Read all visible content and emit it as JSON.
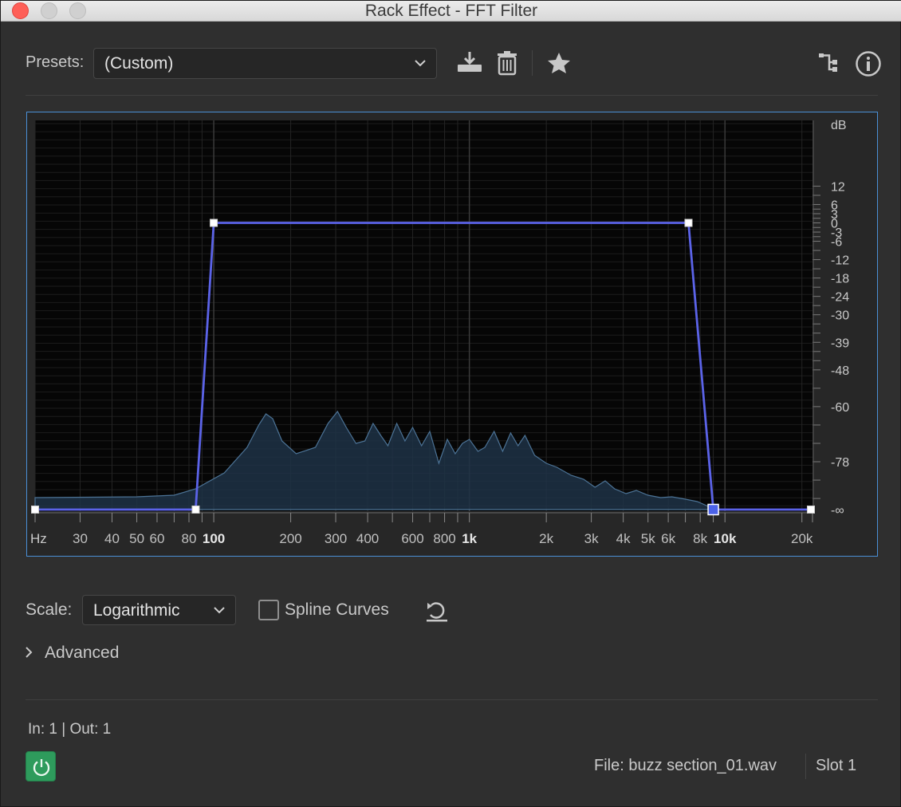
{
  "window": {
    "title": "Rack Effect - FFT Filter"
  },
  "header": {
    "presets_label": "Presets:",
    "preset_value": "(Custom)",
    "icons": [
      "save-preset-icon",
      "delete-icon",
      "favorite-star-icon",
      "routing-icon",
      "info-icon"
    ]
  },
  "graph": {
    "db_unit": "dB",
    "db_labels": [
      "12",
      "6",
      "3",
      "0",
      "-3",
      "-6",
      "-12",
      "-18",
      "-24",
      "-30",
      "-39",
      "-48",
      "-60",
      "-78",
      "-∞"
    ],
    "hz_unit": "Hz",
    "hz_labels": [
      "30",
      "40",
      "50",
      "60",
      "80",
      "100",
      "200",
      "300",
      "400",
      "600",
      "800",
      "1k",
      "2k",
      "3k",
      "4k",
      "5k",
      "6k",
      "8k",
      "10k",
      "20k"
    ],
    "hz_bold": [
      "100",
      "1k",
      "10k"
    ],
    "curve_color": "#5b63e8",
    "spectrum_color": "#4c7396"
  },
  "chart_data": {
    "type": "line",
    "xscale": "log",
    "xlim": [
      20,
      22000
    ],
    "series": [
      {
        "points": [
          [
            20,
            -1000
          ],
          [
            85,
            -1000
          ],
          [
            100,
            0
          ],
          [
            3300,
            0
          ],
          [
            7200,
            0
          ],
          [
            9000,
            -1000
          ],
          [
            22000,
            -1000
          ]
        ]
      }
    ]
  },
  "controls": {
    "scale_label": "Scale:",
    "scale_value": "Logarithmic",
    "spline_label": "Spline Curves",
    "spline_checked": false,
    "advanced_label": "Advanced"
  },
  "footer": {
    "io": "In: 1 | Out: 1",
    "file": "File: buzz section_01.wav",
    "slot": "Slot 1",
    "power_color": "#2e9b5c"
  }
}
